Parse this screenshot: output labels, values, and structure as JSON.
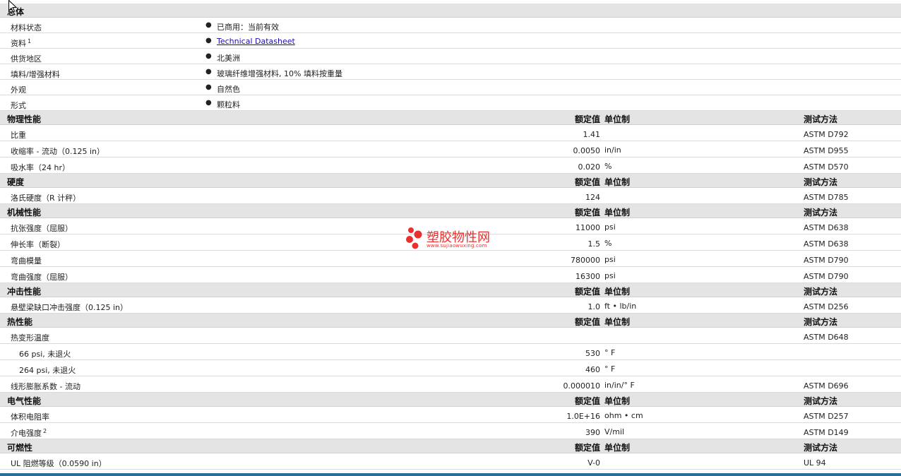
{
  "general": {
    "title": "总体",
    "rows": [
      {
        "label": "材料状态",
        "value": "已商用：当前有效"
      },
      {
        "label": "资料",
        "sup": "1",
        "value": "Technical Datasheet",
        "link": true
      },
      {
        "label": "供货地区",
        "value": "北美洲"
      },
      {
        "label": "填料/增强材料",
        "value": "玻璃纤维增强材料, 10% 填料按重量"
      },
      {
        "label": "外观",
        "value": "自然色"
      },
      {
        "label": "形式",
        "value": "颗粒料"
      }
    ]
  },
  "col_headers": {
    "value": "额定值",
    "unit": "单位制",
    "test": "测试方法"
  },
  "sections": [
    {
      "title": "物理性能",
      "rows": [
        {
          "label": "比重",
          "value": "1.41",
          "unit": "",
          "test": "ASTM D792"
        },
        {
          "label": "收缩率 - 流动（0.125 in）",
          "value": "0.0050",
          "unit": "in/in",
          "test": "ASTM D955"
        },
        {
          "label": "吸水率（24 hr）",
          "value": "0.020",
          "unit": "%",
          "test": "ASTM D570"
        }
      ]
    },
    {
      "title": "硬度",
      "rows": [
        {
          "label": "洛氏硬度（R 计秤）",
          "value": "124",
          "unit": "",
          "test": "ASTM D785"
        }
      ]
    },
    {
      "title": "机械性能",
      "rows": [
        {
          "label": "抗张强度（屈服）",
          "value": "11000",
          "unit": "psi",
          "test": "ASTM D638"
        },
        {
          "label": "伸长率（断裂）",
          "value": "1.5",
          "unit": "%",
          "test": "ASTM D638"
        },
        {
          "label": "弯曲模量",
          "value": "780000",
          "unit": "psi",
          "test": "ASTM D790"
        },
        {
          "label": "弯曲强度（屈服）",
          "value": "16300",
          "unit": "psi",
          "test": "ASTM D790"
        }
      ]
    },
    {
      "title": "冲击性能",
      "rows": [
        {
          "label": "悬壁梁缺口冲击强度（0.125 in）",
          "value": "1.0",
          "unit": "ft • lb/in",
          "test": "ASTM D256"
        }
      ]
    },
    {
      "title": "热性能",
      "rows": [
        {
          "label": "热变形温度",
          "value": "",
          "unit": "",
          "test": "ASTM D648"
        },
        {
          "label": "66 psi, 未退火",
          "value": "530",
          "unit": "° F",
          "test": "",
          "sub": true
        },
        {
          "label": "264 psi, 未退火",
          "value": "460",
          "unit": "° F",
          "test": "",
          "sub": true
        },
        {
          "label": "线形膨胀系数 - 流动",
          "value": "0.000010",
          "unit": "in/in/° F",
          "test": "ASTM D696"
        }
      ]
    },
    {
      "title": "电气性能",
      "rows": [
        {
          "label": "体积电阻率",
          "value": "1.0E+16",
          "unit": "ohm • cm",
          "test": "ASTM D257"
        },
        {
          "label": "介电强度",
          "sup": "2",
          "value": "390",
          "unit": "V/mil",
          "test": "ASTM D149"
        }
      ]
    },
    {
      "title": "可燃性",
      "rows": [
        {
          "label": "UL 阻燃等级（0.0590 in）",
          "value": "V-0",
          "unit": "",
          "test": "UL 94"
        }
      ]
    }
  ],
  "watermark": {
    "name": "塑胶物性网",
    "url": "www.sujiaowuxing.com",
    "color": "#e8312e",
    "icon": "red-dots-logo-icon"
  },
  "colors": {
    "header_bg": "#e4e4e4",
    "link": "#1a0dab",
    "bottom_bar": "#2b6e9a"
  }
}
